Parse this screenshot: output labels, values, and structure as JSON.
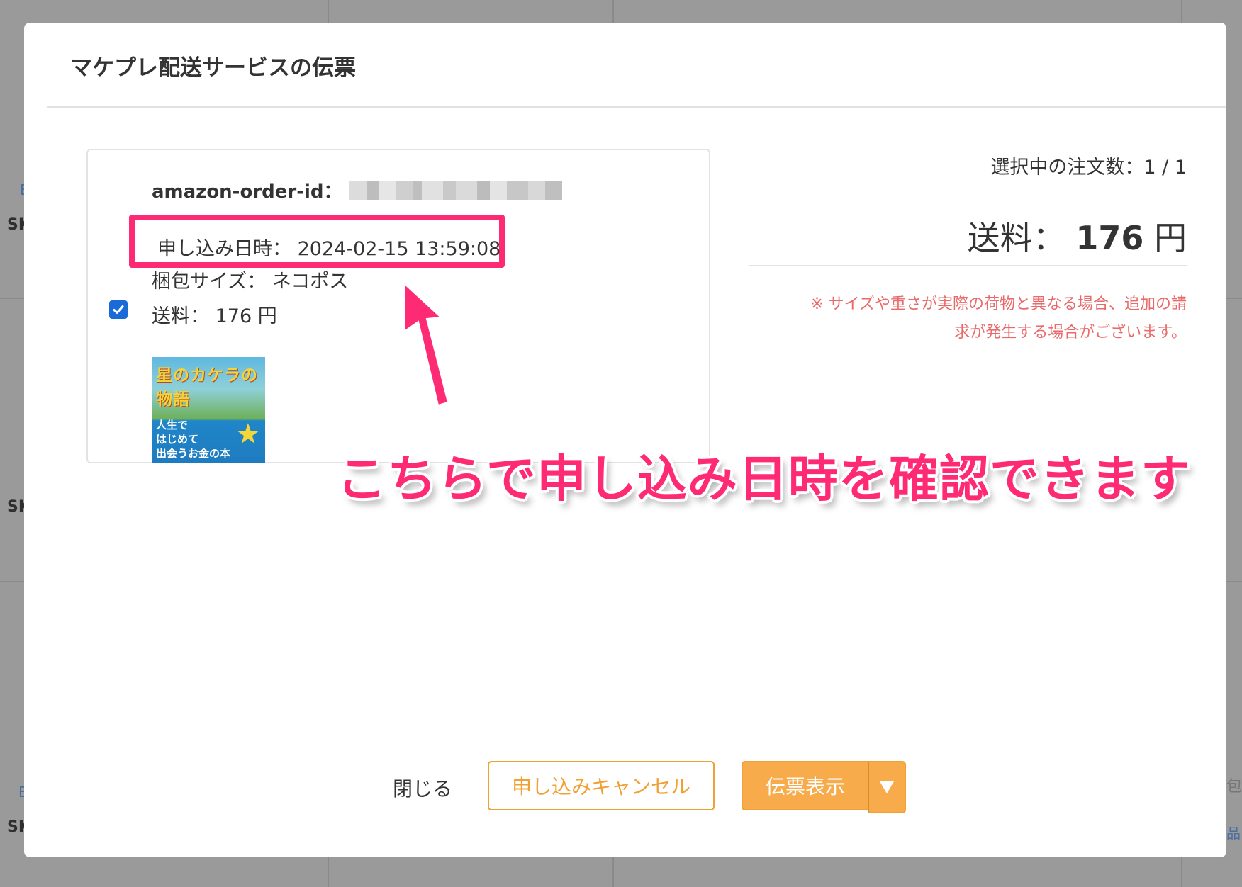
{
  "background": {
    "fragments": [
      "E",
      "SK",
      "SK",
      "E",
      "SK",
      "包",
      "品"
    ]
  },
  "modal": {
    "title": "マケプレ配送サービスの伝票"
  },
  "order": {
    "id_label": "amazon-order-id：",
    "date_label": "申し込み日時： 2024-02-15 13:59:08",
    "package_size": "梱包サイズ： ネコポス",
    "shipping_fee": "送料： 176 円",
    "checked": true,
    "book_cover": {
      "title": "星のカケラの物語",
      "subtitle_line1": "人生で",
      "subtitle_line2": "はじめて",
      "subtitle_line3": "出会うお金の本"
    }
  },
  "summary": {
    "selected_count": "選択中の注文数：1 / 1",
    "fee_label": "送料：",
    "fee_amount": "176",
    "fee_unit": "円",
    "note_line1": "※ サイズや重さが実際の荷物と異なる場合、追加の請",
    "note_line2": "求が発生する場合がございます。"
  },
  "annotation": {
    "text": "こちらで申し込み日時を確認できます",
    "color": "#ff2a74"
  },
  "footer": {
    "close_label": "閉じる",
    "cancel_label": "申し込みキャンセル",
    "show_label": "伝票表示",
    "dropdown_icon": "caret-down-icon"
  },
  "colors": {
    "accent": "#f0a133",
    "highlight": "#ff2a74",
    "warning_text": "#e96a6a",
    "checkbox": "#1a6ad8"
  }
}
